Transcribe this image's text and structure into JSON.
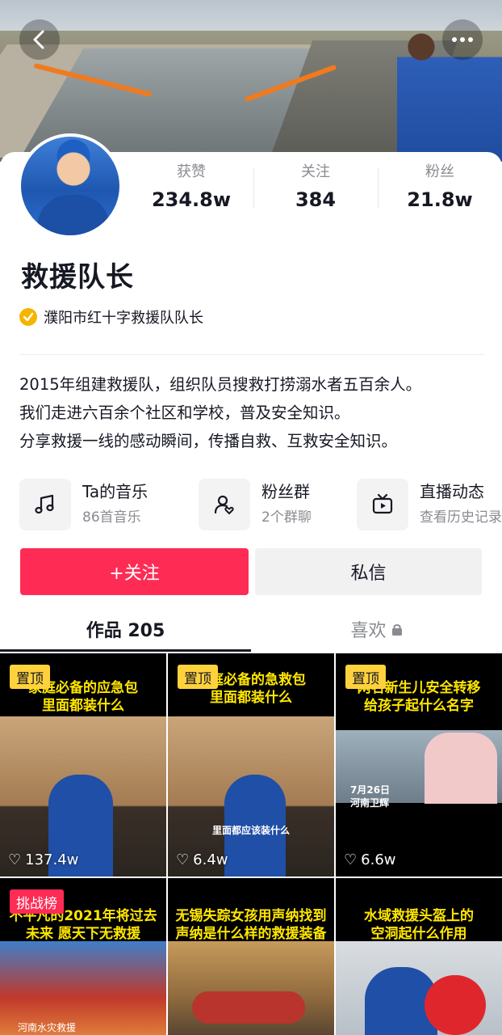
{
  "header": {
    "back_icon": "chevron-left-icon",
    "more_icon": "more-dots-icon"
  },
  "profile": {
    "name": "救援队长",
    "verified_text": "濮阳市红十字救援队队长",
    "stats": [
      {
        "label": "获赞",
        "value": "234.8w"
      },
      {
        "label": "关注",
        "value": "384"
      },
      {
        "label": "粉丝",
        "value": "21.8w"
      }
    ],
    "bio": [
      "2015年组建救援队，组织队员搜救打捞溺水者五百余人。",
      "我们走进六百余个社区和学校，普及安全知识。",
      "分享救援一线的感动瞬间，传播自救、互救安全知识。"
    ]
  },
  "features": [
    {
      "title": "Ta的音乐",
      "sub": "86首音乐",
      "icon": "music-note-icon"
    },
    {
      "title": "粉丝群",
      "sub": "2个群聊",
      "icon": "fan-group-icon"
    },
    {
      "title": "直播动态",
      "sub": "查看历史记录",
      "icon": "tv-icon"
    }
  ],
  "actions": {
    "follow": "+关注",
    "message": "私信"
  },
  "tabs": {
    "works": "作品 205",
    "likes": "喜欢"
  },
  "videos": [
    {
      "badge": "置顶",
      "caption1": "家庭必备的应急包",
      "caption2": "里面都装什么",
      "likes": "137.4w"
    },
    {
      "badge": "置顶",
      "caption1": "家庭必备的急救包",
      "caption2": "里面都装什么",
      "subcaption": "里面都应该装什么",
      "likes": "6.4w"
    },
    {
      "badge": "置顶",
      "caption1": "网名新生儿安全转移",
      "caption2": "给孩子起什么名字",
      "overlay1": "7月26日",
      "overlay2": "河南卫辉",
      "likes": "6.6w"
    },
    {
      "badge": "挑战榜",
      "caption1": "不平凡的2021年将过去",
      "caption2": "未来 愿天下无救援",
      "overlay1": "河南水灾救援"
    },
    {
      "caption1": "无锡失踪女孩用声纳找到",
      "caption2": "声纳是什么样的救援装备"
    },
    {
      "caption1": "水域救援头盔上的",
      "caption2": "空洞起什么作用"
    }
  ],
  "colors": {
    "accent": "#fe2c55",
    "badge_yellow": "#ffd23d",
    "caption_yellow": "#ffe600",
    "verified": "#f4b400"
  }
}
